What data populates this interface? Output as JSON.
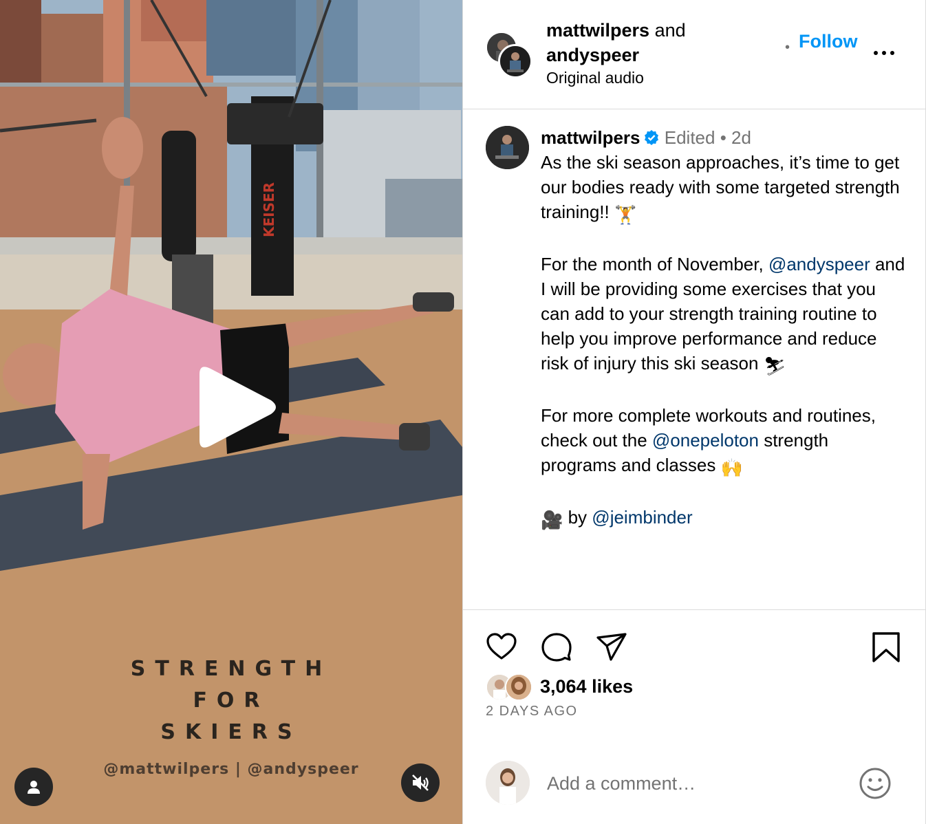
{
  "media": {
    "overlay_title_lines": [
      "STRENGTH",
      "FOR",
      "SKIERS"
    ],
    "overlay_credit": "@mattwilpers | @andyspeer",
    "equipment_label": "KEISER"
  },
  "header": {
    "user1": "mattwilpers",
    "joiner": "and",
    "user2": "andyspeer",
    "audio": "Original audio",
    "separator": "•",
    "follow_label": "Follow"
  },
  "caption": {
    "username": "mattwilpers",
    "edited": "Edited",
    "separator": "•",
    "age": "2d",
    "p1_text": "As the ski season approaches, it’s time to get our bodies ready with some targeted strength training!! ",
    "p1_emoji": "🏋",
    "p2_a": "For the month of November, ",
    "p2_mention": "@andyspeer",
    "p2_b": " and I will be providing some exercises that you can add to your strength training routine to help you improve performance and reduce risk of injury this ski season ",
    "p2_emoji": "⛷",
    "p3_a": "For more complete workouts and routines, check out the ",
    "p3_mention": "@onepeloton",
    "p3_b": " strength programs and classes ",
    "p3_emoji": "🙌",
    "p4_emoji": "🎥",
    "p4_by": " by ",
    "p4_mention": "@jeimbinder"
  },
  "actions": {
    "likes": "3,064 likes",
    "time": "2 DAYS AGO"
  },
  "comment": {
    "placeholder": "Add a comment…"
  },
  "colors": {
    "follow": "#0095f6",
    "mention": "#00376b",
    "muted": "#737373",
    "verified": "#0095f6"
  },
  "icons": [
    "play-icon",
    "user-tag-icon",
    "muted-speaker-icon",
    "verified-badge-icon",
    "more-icon",
    "heart-icon",
    "comment-icon",
    "share-icon",
    "bookmark-icon",
    "emoji-smiley-icon"
  ]
}
